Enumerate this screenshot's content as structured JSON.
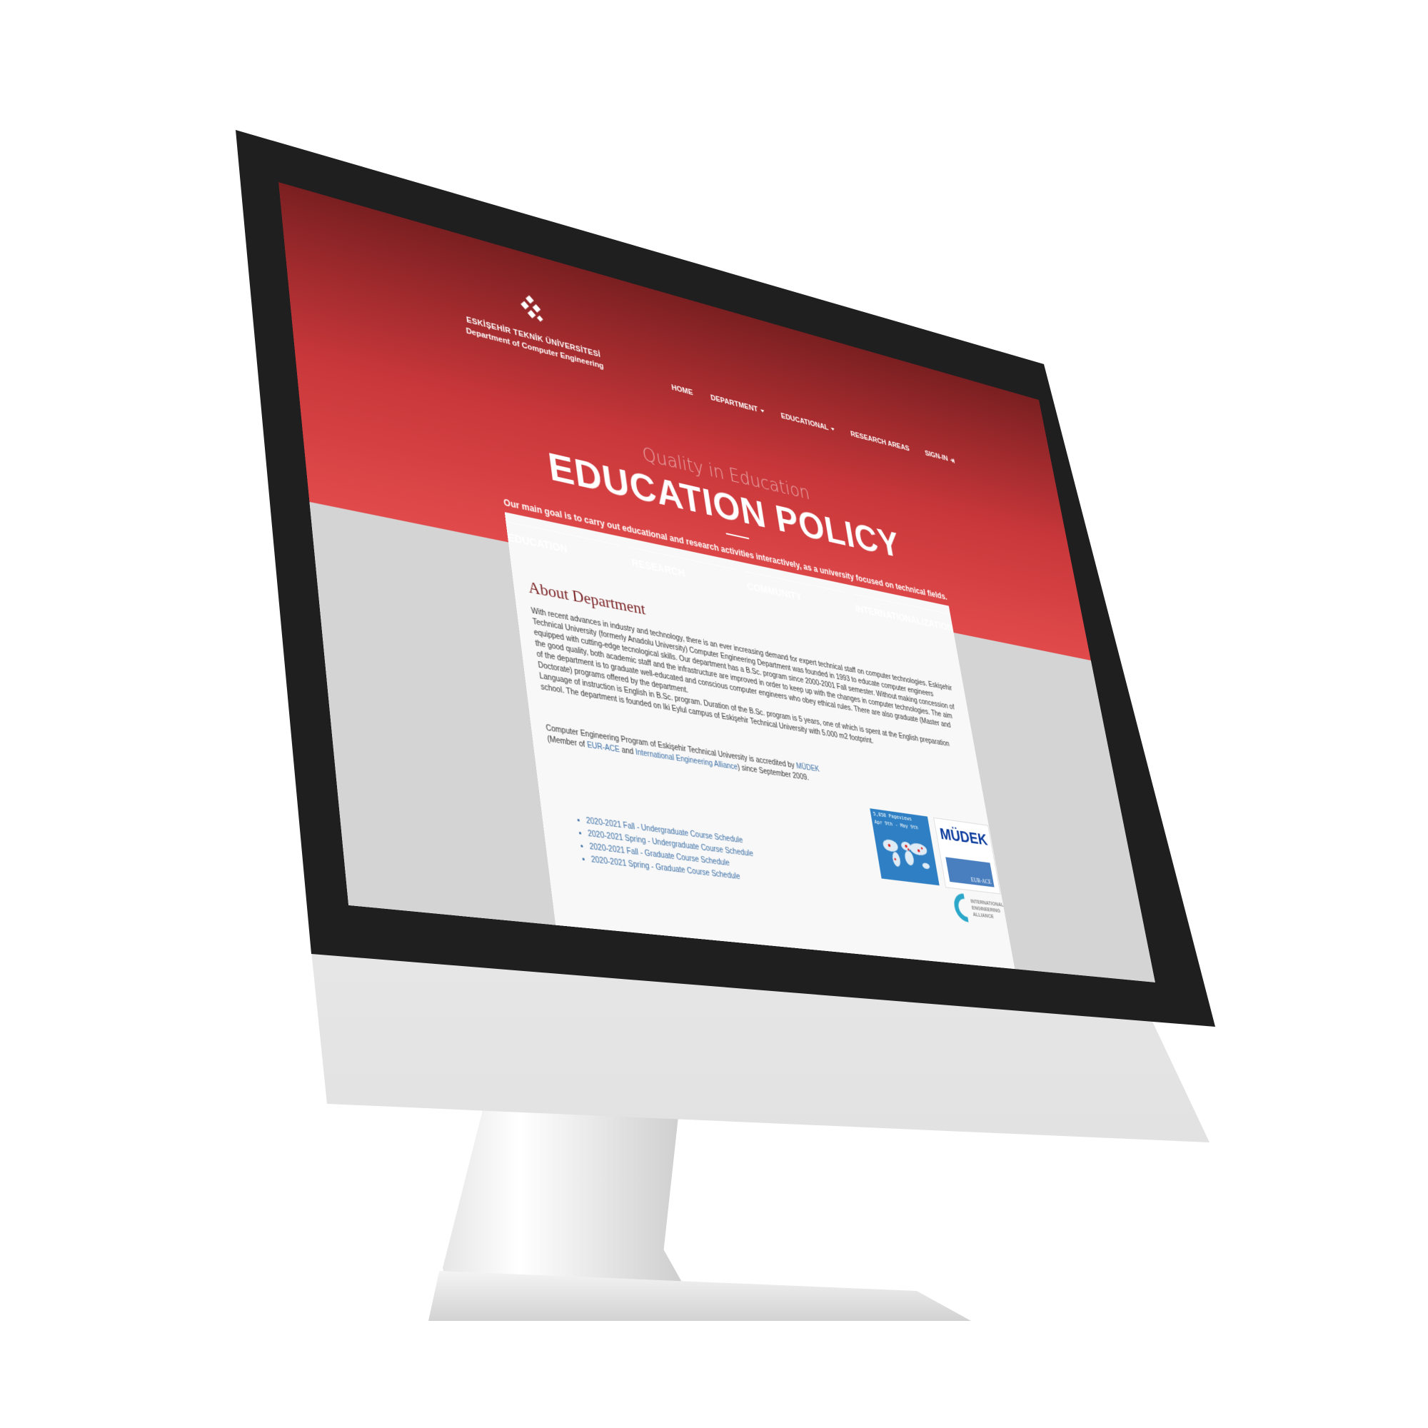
{
  "header": {
    "univ_name": "ESKİŞEHİR TEKNİK ÜNİVERSİTESİ",
    "dept_name": "Department of Computer Engineering"
  },
  "nav": {
    "home": "HOME",
    "department": "DEPARTMENT",
    "educational": "EDUCATIONAL",
    "research_areas": "RESEARCH AREAS",
    "sign_in": "SIGN-IN"
  },
  "hero": {
    "subtitle": "Quality in Education",
    "title": "EDUCATION POLICY",
    "description": "Our main goal is to carry out educational and research activities interactively, as a university focused on technical fields."
  },
  "categories": [
    "EDUCATION",
    "RESEARCH",
    "COMMUNITY",
    "INTERNATIONALIZATION"
  ],
  "about": {
    "title": "About Department",
    "para1": "With recent advances in industry and technology, there is an ever increasing demand for expert technical staff on computer technologies. Eskişehir Technical University (formerly Anadolu University) Computer Engineering Department was founded in 1993 to educate computer engineers equipped with cutting-edge tecnological skills. Our department has a B.Sc. program since 2000-2001 Fall semester. Without making concession of the good quality, both academic staff and the infrastructure are improved in order to keep up with the changes in computer technologies. The aim of the department is to graduate well-educated and conscious computer engineers who obey ethical rules. There are also graduate (Master and Doctorate) programs offered by the department.",
    "para2": "Language of instruction is English in B.Sc. program. Duration of the B.Sc. program is 5 years, one of which is spent at the English preparation school. The department is founded on Iki Eylul campus of Eskişehir Technical University with 5.000 m2 footprint.",
    "para3_a": "Computer Engineering Program of Eskişehir Technical University is accredited by ",
    "mudek_link": "MÜDEK",
    "para3_b": " (Member of ",
    "eurace_link": "EUR-ACE",
    "para3_c": " and ",
    "iea_link": "International Engineering Alliance",
    "para3_d": ") since September 2009."
  },
  "schedules": [
    "2020-2021 Fall - Undergraduate Course Schedule",
    "2020-2021 Spring - Undergraduate Course Schedule",
    "2020-2021 Fall - Graduate Course Schedule",
    "2020-2021 Spring - Graduate Course Schedule"
  ],
  "widgets": {
    "visitor_line1": "5,858 Pageviews",
    "visitor_line2": "Apr 9th - May 9th",
    "mudek_logo": "MÜDEK",
    "eurace_logo": "EUR-ACE",
    "iea_logo": "INTERNATIONAL ENGINEERING ALLIANCE"
  },
  "colors": {
    "hero_dark": "#7a1f21",
    "hero_light": "#e14a4b",
    "link": "#3a6ea5",
    "bezel": "#1f1f1f"
  }
}
